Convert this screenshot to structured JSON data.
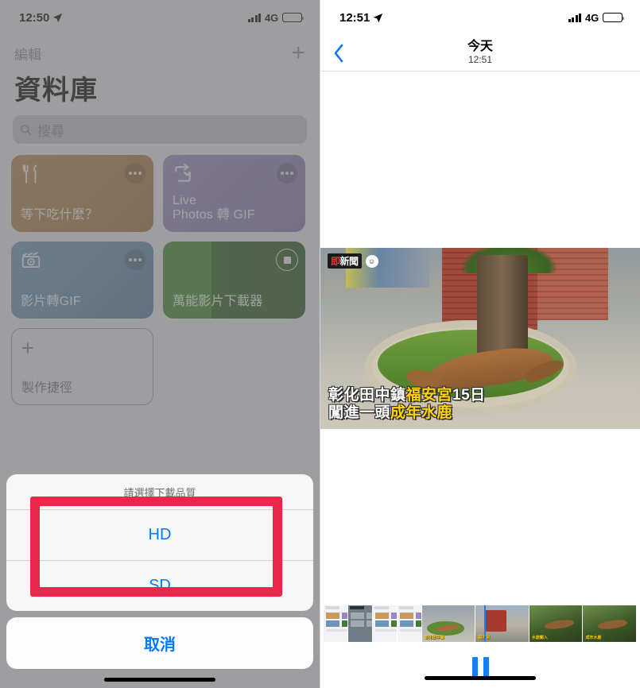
{
  "left_phone": {
    "status_bar": {
      "time": "12:50",
      "network": "4G",
      "location_icon": "location-arrow-icon"
    },
    "nav": {
      "edit_label": "編輯",
      "add_label": "+"
    },
    "page_title": "資料庫",
    "search": {
      "placeholder": "搜尋",
      "icon": "search-icon"
    },
    "tiles": [
      {
        "label": "等下吃什麼？",
        "icon": "fork-knife-icon",
        "color": "#b07d45",
        "menu": "ellipsis-icon"
      },
      {
        "label": "Live\nPhotos 轉 GIF",
        "line1": "Live",
        "line2": "Photos 轉 GIF",
        "icon": "repeat-icon",
        "color": "#8d7fb8",
        "menu": "ellipsis-icon"
      },
      {
        "label": "影片轉GIF",
        "icon": "clapperboard-play-icon",
        "color": "#5b88ae",
        "menu": "ellipsis-icon"
      },
      {
        "label": "萬能影片下載器",
        "icon": "stop-circle-icon",
        "color": "#2d6b20",
        "menu": "stop-icon",
        "running": true
      }
    ],
    "create_tile": {
      "plus": "+",
      "label": "製作捷徑"
    },
    "action_sheet": {
      "title": "請選擇下載品質",
      "options": [
        "HD",
        "SD"
      ],
      "cancel": "取消"
    },
    "annotation": {
      "shape": "rectangle",
      "color": "#e8274b"
    }
  },
  "right_phone": {
    "status_bar": {
      "time": "12:51",
      "network": "4G",
      "location_icon": "location-arrow-icon"
    },
    "nav": {
      "back_icon": "chevron-left-icon",
      "title": "今天",
      "subtitle": "12:51"
    },
    "video": {
      "watermark": {
        "prefix": "即",
        "text": "新聞",
        "badge": "smile-icon"
      },
      "caption_line1_plain_a": "彰化田中鎮",
      "caption_line1_highlight": "福安宮",
      "caption_line1_plain_b": "15日",
      "caption_line2_plain": "闖進一頭",
      "caption_line2_highlight": "成年水鹿",
      "highlight_color": "#ffd400"
    },
    "filmstrip": {
      "thumbnails": [
        "screenshot-1",
        "screenshot-2-dark",
        "screenshot-3",
        "screenshot-4",
        "video-frame-1",
        "video-frame-2",
        "video-frame-3",
        "video-frame-4"
      ],
      "playhead_color": "#157efb"
    },
    "controls": {
      "pause_icon": "pause-icon",
      "accent": "#157efb"
    }
  }
}
